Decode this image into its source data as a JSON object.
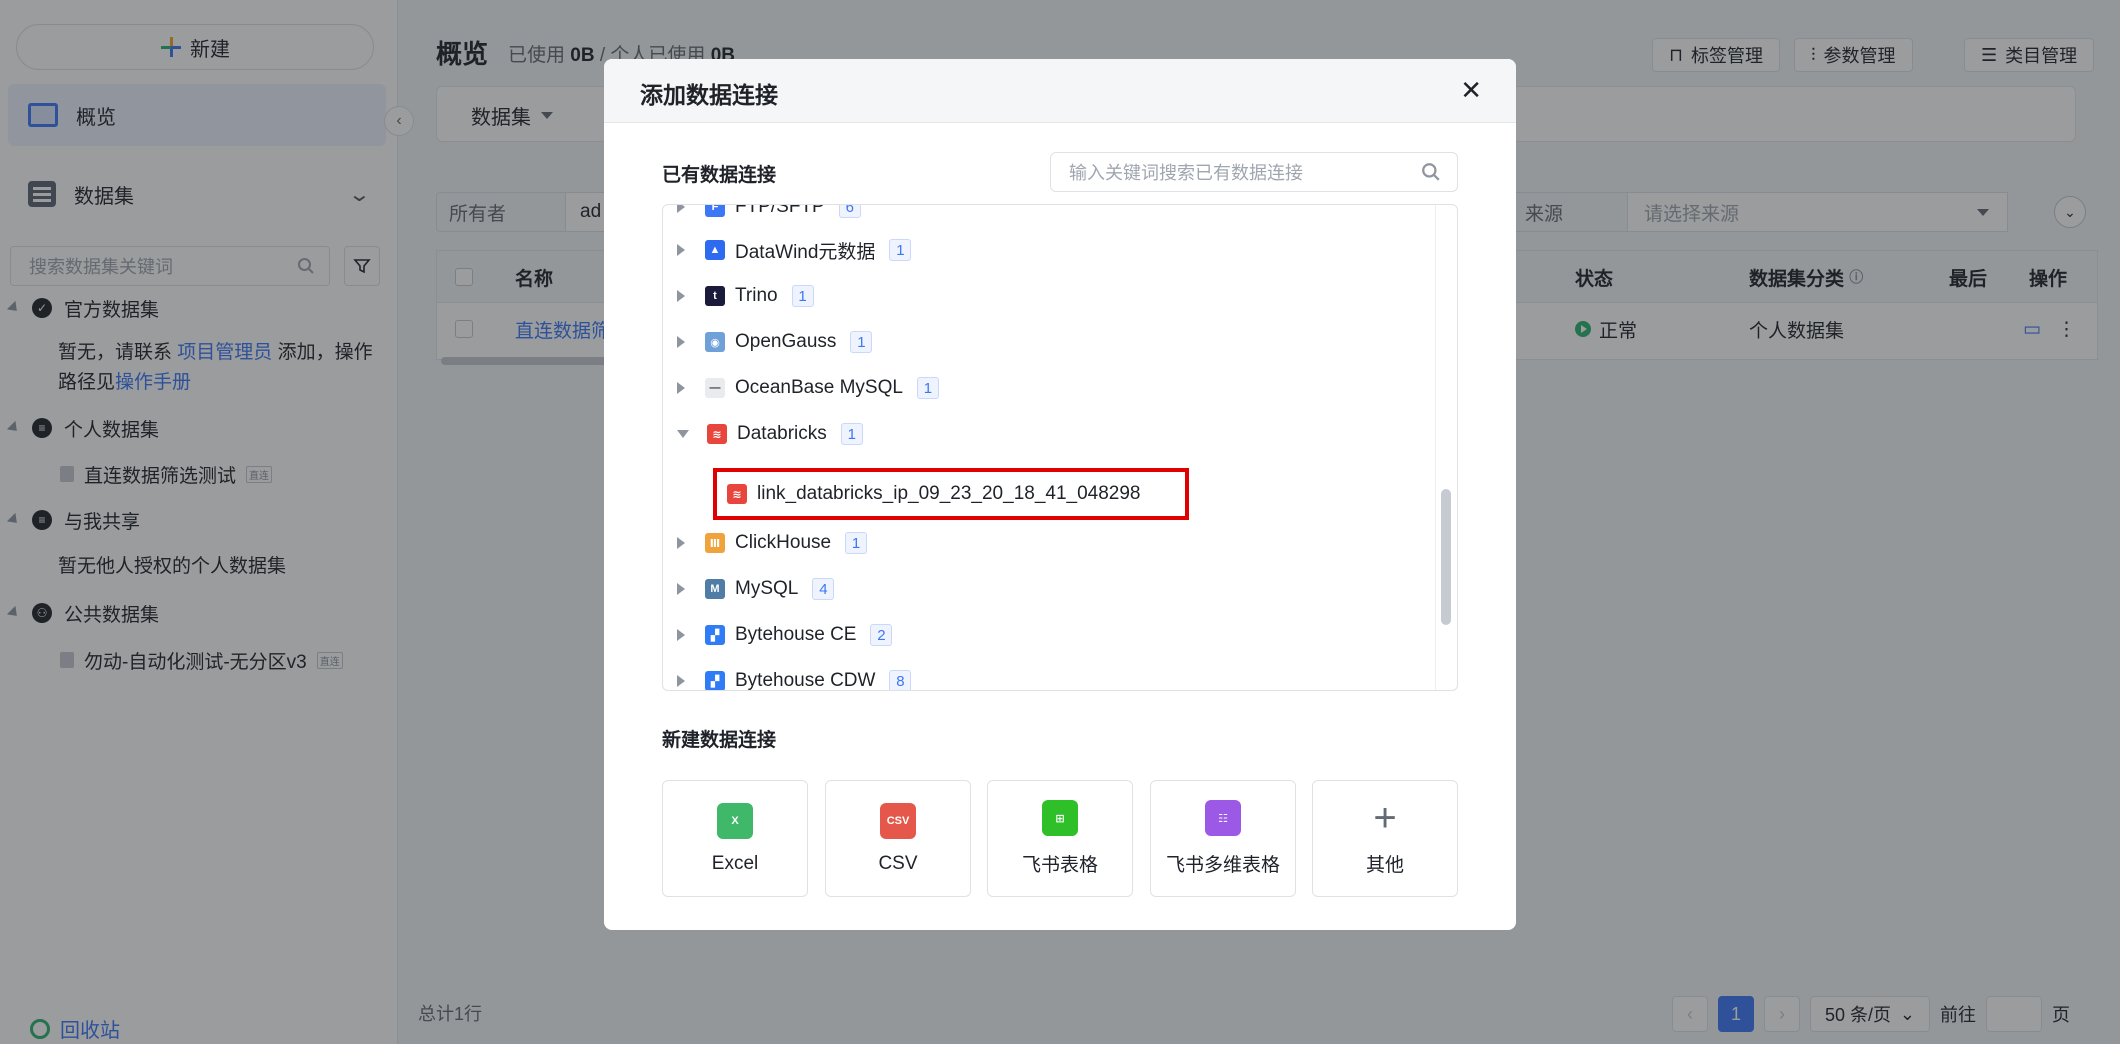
{
  "sidebar": {
    "new_label": "新建",
    "overview_label": "概览",
    "dataset_label": "数据集",
    "search_placeholder": "搜索数据集关键词",
    "official_title": "官方数据集",
    "official_empty_1": "暂无，请联系",
    "official_empty_link": "项目管理员",
    "official_empty_2": "添加，操作",
    "official_empty_3": "路径见",
    "official_empty_link2": "操作手册",
    "personal_title": "个人数据集",
    "personal_item": "直连数据筛选测试",
    "shared_title": "与我共享",
    "shared_empty": "暂无他人授权的个人数据集",
    "public_title": "公共数据集",
    "public_item": "勿动-自动化测试-无分区v3",
    "tag_small": "直连",
    "recycle_label": "回收站"
  },
  "main": {
    "title": "概览",
    "usage_prefix": "已使用",
    "usage_value": "0B",
    "usage_sep": "/ 个人已使用",
    "personal_usage": "0B",
    "btn_tags": "标签管理",
    "btn_params": "参数管理",
    "btn_category": "类目管理",
    "tab_active": "数据集",
    "owner_label": "所有者",
    "owner_value": "ad",
    "source_label": "来源",
    "source_placeholder": "请选择来源",
    "table": {
      "headers": {
        "name": "名称",
        "status": "状态",
        "category": "数据集分类",
        "last": "最后",
        "ops": "操作"
      },
      "row": {
        "name": "直连数据筛",
        "status": "正常",
        "category": "个人数据集"
      }
    },
    "total": "总计1行",
    "pager": {
      "current": "1",
      "size": "50 条/页",
      "goto": "前往",
      "page": "页"
    }
  },
  "modal": {
    "title": "添加数据连接",
    "existing_title": "已有数据连接",
    "search_placeholder": "输入关键词搜索已有数据连接",
    "connections": [
      {
        "name": "FTP/SFTP",
        "count": "6"
      },
      {
        "name": "DataWind元数据",
        "count": "1"
      },
      {
        "name": "Trino",
        "count": "1"
      },
      {
        "name": "OpenGauss",
        "count": "1"
      },
      {
        "name": "OceanBase MySQL",
        "count": "1"
      },
      {
        "name": "Databricks",
        "count": "1"
      },
      {
        "name": "ClickHouse",
        "count": "1"
      },
      {
        "name": "MySQL",
        "count": "4"
      },
      {
        "name": "Bytehouse CE",
        "count": "2"
      },
      {
        "name": "Bytehouse CDW",
        "count": "8"
      }
    ],
    "expanded_child": "link_databricks_ip_09_23_20_18_41_048298",
    "new_title": "新建数据连接",
    "new_cards": [
      {
        "label": "Excel",
        "icon": "excel-icon",
        "color": "#3fb86a"
      },
      {
        "label": "CSV",
        "icon": "csv-icon",
        "color": "#e5574b"
      },
      {
        "label": "飞书表格",
        "icon": "lark-sheet-icon",
        "color": "#2fbf29"
      },
      {
        "label": "飞书多维表格",
        "icon": "lark-bitable-icon",
        "color": "#9b59e6"
      },
      {
        "label": "其他",
        "icon": "plus-icon"
      }
    ]
  },
  "colors": {
    "accent": "#3b77f6",
    "highlight_border": "#e00000",
    "success": "#2ab26d"
  }
}
